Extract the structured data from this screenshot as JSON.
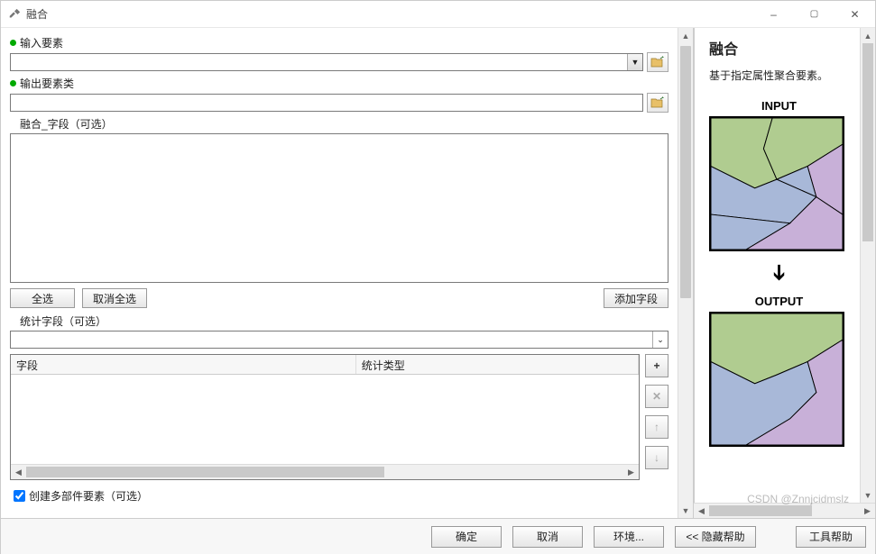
{
  "window": {
    "title": "融合",
    "min_label": "–",
    "max_label": "▢",
    "close_label": "✕"
  },
  "form": {
    "input_features": {
      "label": "输入要素",
      "value": ""
    },
    "output_class": {
      "label": "输出要素类",
      "value": ""
    },
    "dissolve_fields": {
      "label": "融合_字段（可选）"
    },
    "buttons": {
      "select_all": "全选",
      "deselect_all": "取消全选",
      "add_field": "添加字段"
    },
    "stats_field": {
      "label": "统计字段（可选）",
      "value": ""
    },
    "table": {
      "col_field": "字段",
      "col_stat": "统计类型"
    },
    "side_icons": {
      "add": "+",
      "remove": "✕",
      "up": "↑",
      "down": "↓"
    },
    "multipart": {
      "label": "创建多部件要素（可选）",
      "checked": true
    }
  },
  "footer": {
    "ok": "确定",
    "cancel": "取消",
    "env": "环境...",
    "hide_help": "<< 隐藏帮助",
    "tool_help": "工具帮助"
  },
  "help": {
    "title": "融合",
    "desc": "基于指定属性聚合要素。",
    "input_label": "INPUT",
    "output_label": "OUTPUT"
  },
  "watermark": "CSDN @Znnjcidmslz"
}
